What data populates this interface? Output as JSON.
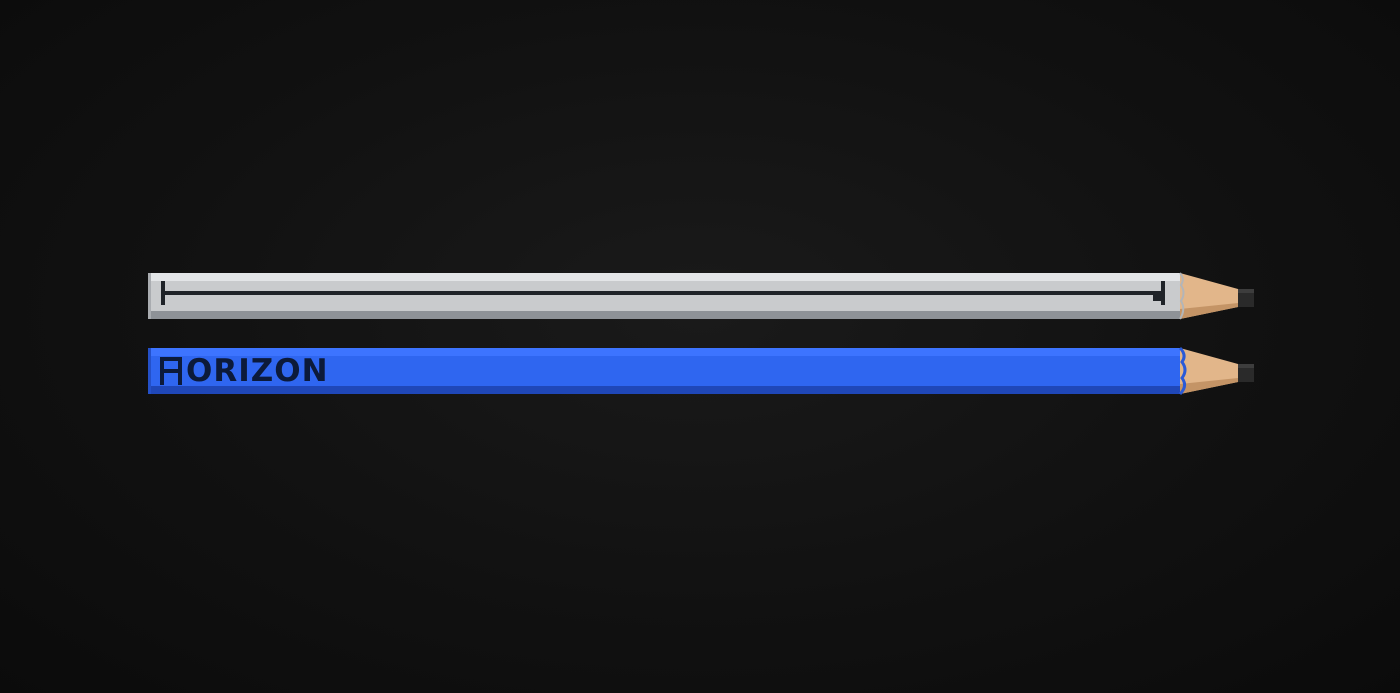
{
  "scene": {
    "background_color": "#111111"
  },
  "pencils": [
    {
      "name": "grey-pencil",
      "body_color": "#c9cbcd",
      "shade_color": "#8e9297",
      "mark_color": "#1f2328",
      "wood_color": "#e2b68a",
      "lead_color": "#2a2a2a",
      "graphic": "horizon-line-mark"
    },
    {
      "name": "blue-pencil",
      "body_color": "#2f66f0",
      "shade_color": "#1f47b8",
      "mark_color": "#0c1a3a",
      "wood_color": "#e2b68a",
      "lead_color": "#2a2a2a",
      "graphic": "horizon-wordmark",
      "wordmark": "ORIZON"
    }
  ]
}
